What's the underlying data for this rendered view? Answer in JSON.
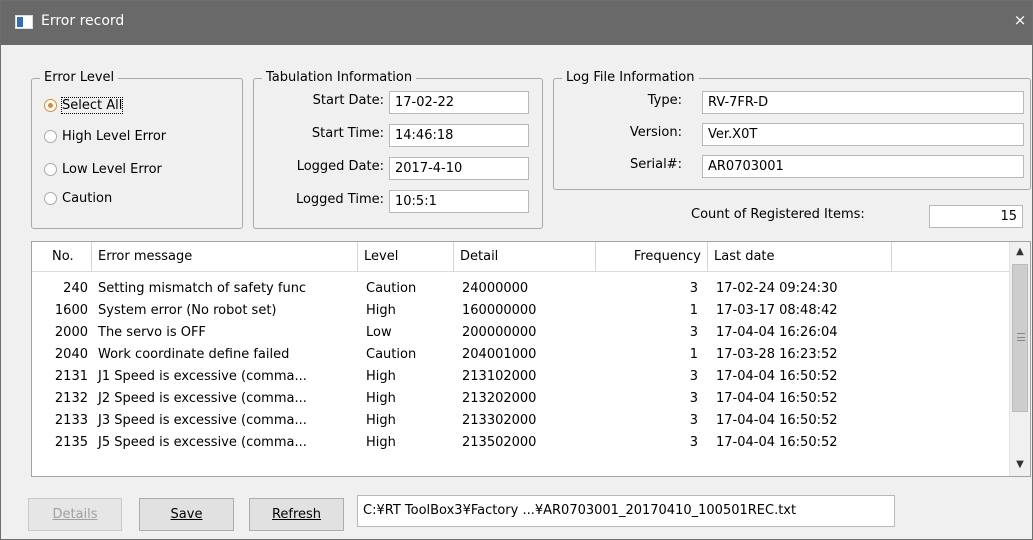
{
  "window": {
    "title": "Error record",
    "close_glyph": "×"
  },
  "error_level": {
    "legend": "Error Level",
    "options": [
      {
        "label": "Select All",
        "checked": true
      },
      {
        "label": "High Level Error",
        "checked": false
      },
      {
        "label": "Low Level Error",
        "checked": false
      },
      {
        "label": "Caution",
        "checked": false
      }
    ]
  },
  "tabulation": {
    "legend": "Tabulation Information",
    "start_date_label": "Start Date:",
    "start_date": "17-02-22",
    "start_time_label": "Start Time:",
    "start_time": "14:46:18",
    "logged_date_label": "Logged Date:",
    "logged_date": "2017-4-10",
    "logged_time_label": "Logged Time:",
    "logged_time": "10:5:1"
  },
  "log_file": {
    "legend": "Log File Information",
    "type_label": "Type:",
    "type": "RV-7FR-D",
    "version_label": "Version:",
    "version": "Ver.X0T",
    "serial_label": "Serial#:",
    "serial": "AR0703001"
  },
  "count": {
    "label": "Count of Registered Items:",
    "value": "15"
  },
  "table": {
    "columns": [
      "No.",
      "Error message",
      "Level",
      "Detail",
      "Frequency",
      "Last date"
    ],
    "rows": [
      {
        "no": "240",
        "message": "Setting mismatch of safety func",
        "level": "Caution",
        "detail": "24000000",
        "frequency": "3",
        "last_date": "17-02-24 09:24:30"
      },
      {
        "no": "1600",
        "message": "System error (No robot set)",
        "level": "High",
        "detail": "160000000",
        "frequency": "1",
        "last_date": "17-03-17 08:48:42"
      },
      {
        "no": "2000",
        "message": "The servo is OFF",
        "level": "Low",
        "detail": "200000000",
        "frequency": "3",
        "last_date": "17-04-04 16:26:04"
      },
      {
        "no": "2040",
        "message": "Work coordinate define failed",
        "level": "Caution",
        "detail": "204001000",
        "frequency": "1",
        "last_date": "17-03-28 16:23:52"
      },
      {
        "no": "2131",
        "message": "J1 Speed is excessive (comma...",
        "level": "High",
        "detail": "213102000",
        "frequency": "3",
        "last_date": "17-04-04 16:50:52"
      },
      {
        "no": "2132",
        "message": "J2 Speed is excessive (comma...",
        "level": "High",
        "detail": "213202000",
        "frequency": "3",
        "last_date": "17-04-04 16:50:52"
      },
      {
        "no": "2133",
        "message": "J3 Speed is excessive (comma...",
        "level": "High",
        "detail": "213302000",
        "frequency": "3",
        "last_date": "17-04-04 16:50:52"
      },
      {
        "no": "2135",
        "message": "J5 Speed is excessive (comma...",
        "level": "High",
        "detail": "213502000",
        "frequency": "3",
        "last_date": "17-04-04 16:50:52"
      }
    ]
  },
  "scrollbar": {
    "up_glyph": "▲",
    "down_glyph": "▼"
  },
  "buttons": {
    "details": "Details",
    "save": "Save",
    "refresh": "Refresh"
  },
  "file_path": "C:¥RT ToolBox3¥Factory ...¥AR0703001_20170410_100501REC.txt",
  "colors": {
    "titlebar": "#696969",
    "radio_accent": "#e08a2a"
  }
}
